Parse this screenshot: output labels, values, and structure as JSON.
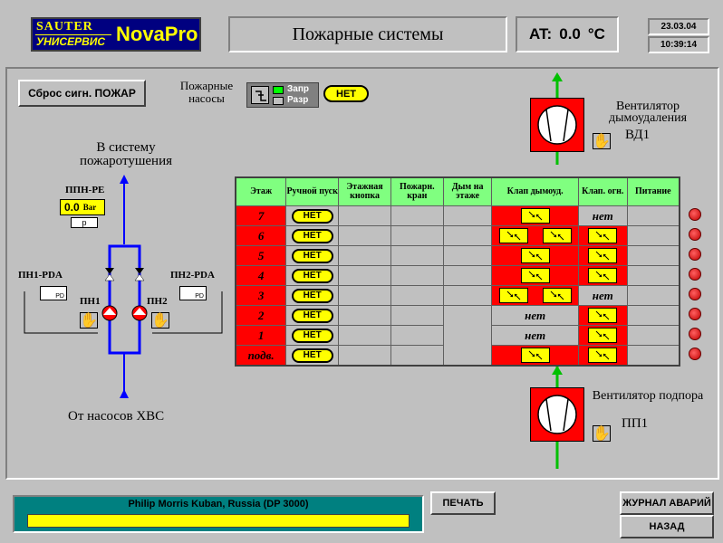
{
  "header": {
    "logo_top": "SAUTER",
    "logo_bottom": "УНИСЕРВИС",
    "logo_product": "NovaPro",
    "title": "Пожарные системы",
    "at_label": "AT:",
    "at_value": "0.0",
    "at_unit": "°C",
    "date": "23.03.04",
    "time": "10:39:14"
  },
  "controls": {
    "reset_button": "Сброс сигн. ПОЖАР",
    "pumps_label": "Пожарные насосы",
    "mode_forbid": "Запр",
    "mode_allow": "Разр",
    "pumps_status": "НЕТ"
  },
  "left_scheme": {
    "to_system": "В систему пожаротушения",
    "from_pumps": "От насосов ХВС",
    "ppn_label": "ППН-РЕ",
    "ppn_value": "0.0",
    "ppn_unit": "Bar",
    "ppn_sensor": "p",
    "pn1_pda": "ПН1-PDA",
    "pn2_pda": "ПН2-PDA",
    "pn1": "ПН1",
    "pn2": "ПН2",
    "pd": "PD"
  },
  "fans": {
    "smoke_title": "Вентилятор дымоудаления",
    "smoke_id": "ВД1",
    "supply_title": "Вентилятор подпора",
    "supply_id": "ПП1"
  },
  "table": {
    "headers": [
      "Этаж",
      "Ручной пуск",
      "Этажная кнопка",
      "Пожарн. кран",
      "Дым на этаже",
      "Клап дымоуд.",
      "Клап. огн.",
      "Питание"
    ],
    "rows": [
      {
        "floor": "7",
        "manual": "НЕТ",
        "smoke_valves": 1,
        "fire": "нет"
      },
      {
        "floor": "6",
        "manual": "НЕТ",
        "smoke_valves": 2,
        "fire": "valve"
      },
      {
        "floor": "5",
        "manual": "НЕТ",
        "smoke_valves": 1,
        "fire": "valve"
      },
      {
        "floor": "4",
        "manual": "НЕТ",
        "smoke_valves": 1,
        "fire": "valve"
      },
      {
        "floor": "3",
        "manual": "НЕТ",
        "smoke_valves": 2,
        "fire": "нет"
      },
      {
        "floor": "2",
        "manual": "НЕТ",
        "smoke_valves": 0,
        "smoke_text": "нет",
        "fire": "valve"
      },
      {
        "floor": "1",
        "manual": "НЕТ",
        "smoke_valves": 0,
        "smoke_text": "нет",
        "fire": "valve"
      },
      {
        "floor": "подв.",
        "manual": "НЕТ",
        "smoke_valves": 1,
        "fire": "valve"
      }
    ]
  },
  "footer": {
    "company": "Philip Morris Kuban, Russia (DP 3000)",
    "print": "ПЕЧАТЬ",
    "alarm_log": "ЖУРНАЛ АВАРИЙ",
    "back": "НАЗАД"
  },
  "colors": {
    "background": "#c0c0c0",
    "alarm": "#ff0000",
    "header_green": "#80ff80",
    "status_yellow": "#ffff00",
    "pipe_blue": "#0000ff",
    "air_green": "#00c000",
    "logo_navy": "#000080",
    "footer_teal": "#008080"
  }
}
